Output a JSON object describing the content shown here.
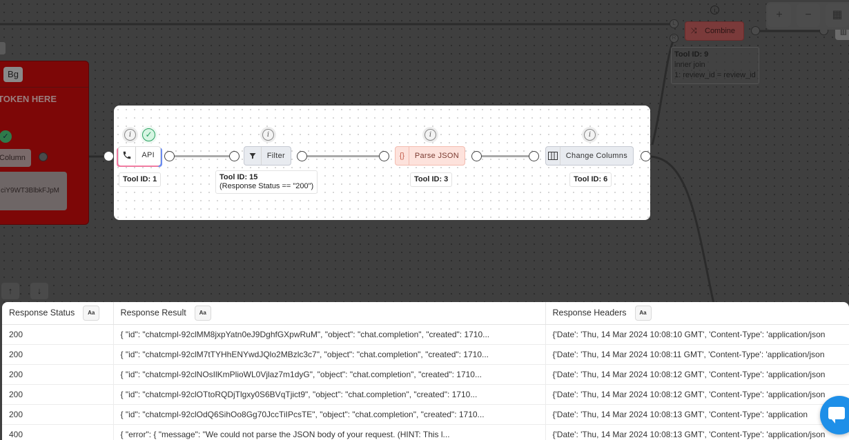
{
  "background_nodes": {
    "bg_label": "Bg",
    "token_text": "TOKEN HERE",
    "column_label": "Column",
    "token_value": "ciY9WT3BlbkFJpM",
    "combine": {
      "label": "Combine",
      "tool_id": "Tool ID: 9",
      "join_type": "inner join",
      "condition": "1: review_id = review_id",
      "handle_left": "L",
      "handle_right": "R"
    }
  },
  "zoom_controls": {
    "zoom_in": "+",
    "zoom_out": "−"
  },
  "workflow": {
    "nodes": [
      {
        "label": "API",
        "tool_id": "Tool ID: 1"
      },
      {
        "label": "Filter",
        "tool_id": "Tool ID: 15",
        "note": "(Response Status == \"200\")"
      },
      {
        "label": "Parse JSON",
        "tool_id": "Tool ID: 3"
      },
      {
        "label": "Change Columns",
        "tool_id": "Tool ID: 6"
      }
    ]
  },
  "results_table": {
    "type_badge": "Aa",
    "columns": [
      "Response Status",
      "Response Result",
      "Response Headers"
    ],
    "rows": [
      [
        "200",
        "{ \"id\": \"chatcmpl-92clMM8jxpYatn0eJ9DghfGXpwRuM\", \"object\": \"chat.completion\", \"created\": 1710...",
        "{'Date': 'Thu, 14 Mar 2024 10:08:10 GMT', 'Content-Type': 'application/json"
      ],
      [
        "200",
        "{ \"id\": \"chatcmpl-92clM7tTYHhENYwdJQlo2MBzlc3c7\", \"object\": \"chat.completion\", \"created\": 1710...",
        "{'Date': 'Thu, 14 Mar 2024 10:08:11 GMT', 'Content-Type': 'application/json"
      ],
      [
        "200",
        "{ \"id\": \"chatcmpl-92clNOsIlKmPlioWL0Vjlaz7m1dyG\", \"object\": \"chat.completion\", \"created\": 1710...",
        "{'Date': 'Thu, 14 Mar 2024 10:08:12 GMT', 'Content-Type': 'application/json"
      ],
      [
        "200",
        "{ \"id\": \"chatcmpl-92clOTtoRQDjTlgxy0S6BVqTjict9\", \"object\": \"chat.completion\", \"created\": 1710...",
        "{'Date': 'Thu, 14 Mar 2024 10:08:12 GMT', 'Content-Type': 'application/json"
      ],
      [
        "200",
        "{ \"id\": \"chatcmpl-92clOdQ6SihOo8Gg70JccTiIPcsTE\", \"object\": \"chat.completion\", \"created\": 1710...",
        "{'Date': 'Thu, 14 Mar 2024 10:08:13 GMT', 'Content-Type': 'application"
      ],
      [
        "400",
        "{ \"error\": { \"message\": \"We could not parse the JSON body of your request. (HINT: This l...",
        "{'Date': 'Thu, 14 Mar 2024 10:08:13 GMT', 'Content-Type': 'application/json"
      ]
    ]
  }
}
